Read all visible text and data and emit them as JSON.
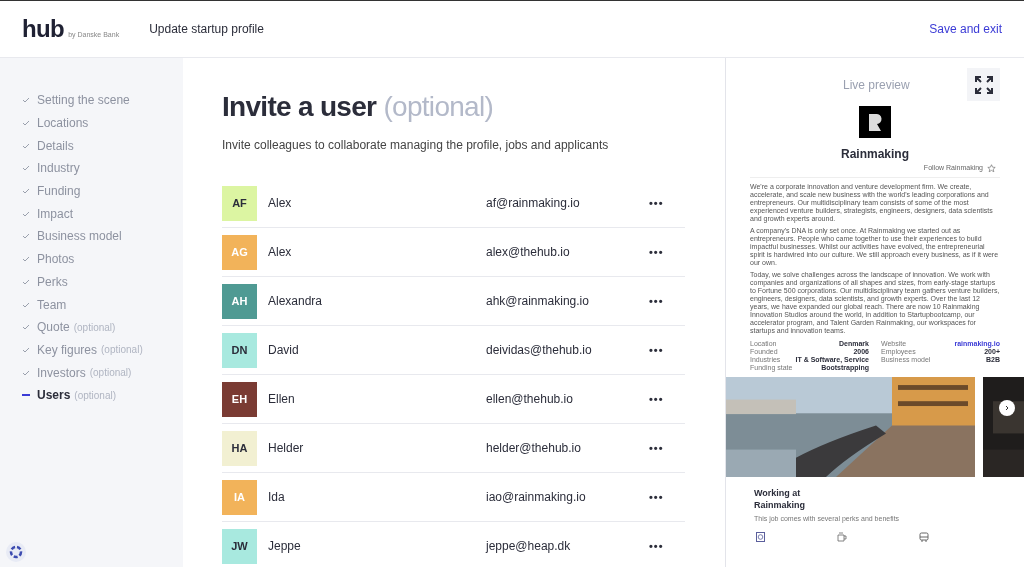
{
  "header": {
    "logo": "hub",
    "logo_sub": "by Danske Bank",
    "title": "Update startup profile",
    "action": "Save and exit"
  },
  "steps": [
    {
      "label": "Setting the scene",
      "completed": true,
      "selected": false
    },
    {
      "label": "Locations",
      "completed": true,
      "selected": false
    },
    {
      "label": "Details",
      "completed": true,
      "selected": false
    },
    {
      "label": "Industry",
      "completed": true,
      "selected": false
    },
    {
      "label": "Funding",
      "completed": true,
      "selected": false
    },
    {
      "label": "Impact",
      "completed": true,
      "selected": false
    },
    {
      "label": "Business model",
      "completed": true,
      "selected": false
    },
    {
      "label": "Photos",
      "completed": true,
      "selected": false
    },
    {
      "label": "Perks",
      "completed": true,
      "selected": false
    },
    {
      "label": "Team",
      "completed": true,
      "selected": false
    },
    {
      "label": "Quote",
      "note": "(optional)",
      "completed": true,
      "selected": false
    },
    {
      "label": "Key figures",
      "note": "(optional)",
      "completed": true,
      "selected": false
    },
    {
      "label": "Investors",
      "note": "(optional)",
      "completed": true,
      "selected": false
    },
    {
      "label": "Users",
      "note": "(optional)",
      "completed": false,
      "selected": true
    }
  ],
  "main": {
    "title": "Invite a user",
    "title_note": "(optional)",
    "subtitle": "Invite colleagues to collaborate managing the profile, jobs and applicants",
    "users": [
      {
        "initials": "AF",
        "color": "#dcf5a2",
        "name": "Alex",
        "email": "af@rainmaking.io",
        "menu": "•••"
      },
      {
        "initials": "AG",
        "color": "#f2b35a",
        "name": "Alex",
        "email": "alex@thehub.io",
        "menu": "•••"
      },
      {
        "initials": "AH",
        "color": "#4f9a93",
        "name": "Alexandra",
        "email": "ahk@rainmaking.io",
        "menu": "•••"
      },
      {
        "initials": "DN",
        "color": "#a8e9df",
        "name": "David",
        "email": "deividas@thehub.io",
        "menu": "•••"
      },
      {
        "initials": "EH",
        "color": "#7a3b33",
        "name": "Ellen",
        "email": "ellen@thehub.io",
        "menu": "•••"
      },
      {
        "initials": "HA",
        "color": "#f2f0d2",
        "name": "Helder",
        "email": "helder@thehub.io",
        "menu": "•••"
      },
      {
        "initials": "IA",
        "color": "#f2b35a",
        "name": "Ida",
        "email": "iao@rainmaking.io",
        "menu": "•••"
      },
      {
        "initials": "JW",
        "color": "#a8e9df",
        "name": "Jeppe",
        "email": "jeppe@heap.dk",
        "menu": "•••"
      }
    ]
  },
  "preview": {
    "title": "Live preview",
    "company": "Rainmaking",
    "follow": "Follow Rainmaking",
    "paragraphs": [
      "We're a corporate innovation and venture development firm. We create, accelerate, and scale new business with the world's leading corporations and entrepreneurs. Our multidisciplinary team consists of some of the most experienced venture builders, strategists, engineers, designers, data scientists and growth experts around.",
      "A company's DNA is only set once. At Rainmaking we started out as entrepreneurs. People who came together to use their experiences to build impactful businesses. Whilst our activities have evolved, the entrepreneurial spirit is hardwired into our culture. We still approach every business, as if it were our own.",
      "Today, we solve challenges across the landscape of innovation. We work with companies and organizations of all shapes and sizes, from early-stage startups to Fortune 500 corporations. Our multidisciplinary team gathers venture builders, engineers, designers, data scientists, and growth experts. Over the last 12 years, we have expanded our global reach. There are now 10 Rainmaking Innovation Studios around the world, in addition to Startupbootcamp, our accelerator program, and Talent Garden Rainmaking, our workspaces for startups and innovation teams."
    ],
    "facts": [
      {
        "label": "Location",
        "value": "Denmark",
        "kind": "text"
      },
      {
        "label": "Website",
        "value": "rainmaking.io",
        "kind": "link"
      },
      {
        "label": "Founded",
        "value": "2006",
        "kind": "text"
      },
      {
        "label": "Employees",
        "value": "200+",
        "kind": "text"
      },
      {
        "label": "Industries",
        "value": "IT & Software, Service",
        "kind": "text"
      },
      {
        "label": "Business model",
        "value": "B2B",
        "kind": "text"
      },
      {
        "label": "Funding state",
        "value": "Bootstrapping",
        "kind": "text"
      }
    ],
    "working_title": "Working at Rainmaking",
    "working_subtitle": "This job comes with several perks and benefits"
  }
}
